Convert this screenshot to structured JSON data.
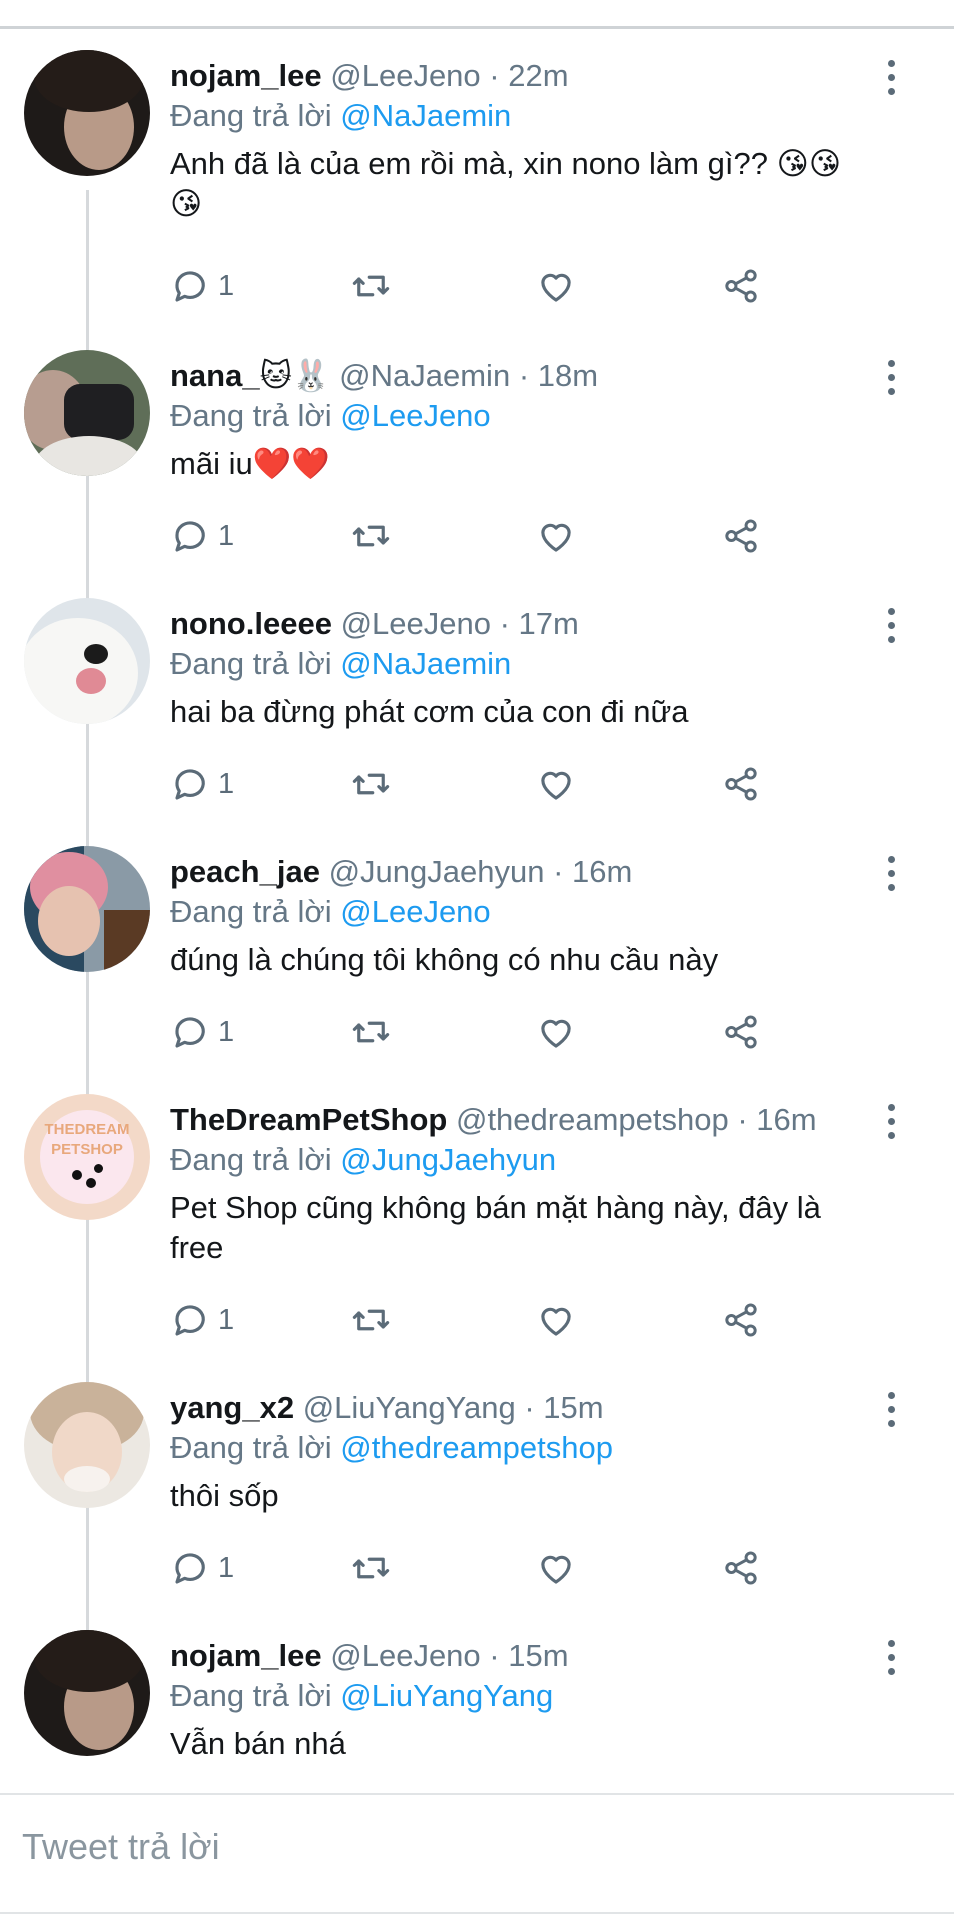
{
  "thread": [
    {
      "name": "nojam_lee",
      "handle": "@LeeJeno",
      "time": "· 22m",
      "reply_prefix": "Đang trả lời",
      "reply_to": "@NaJaemin",
      "text": "Anh đã là của em rồi mà, xin nono làm gì??",
      "emojis": "😘😘😘",
      "reply_count": "1",
      "avatar": "dark-hair-portrait"
    },
    {
      "name": "nana_",
      "name_emojis": "🐱🐰",
      "handle": "@NaJaemin",
      "time": "· 18m",
      "reply_prefix": "Đang trả lời",
      "reply_to": "@LeeJeno",
      "text": "mãi iu",
      "emojis": "❤️❤️",
      "reply_count": "1",
      "avatar": "camera-portrait"
    },
    {
      "name": "nono.leeee",
      "handle": "@LeeJeno",
      "time": "· 17m",
      "reply_prefix": "Đang trả lời",
      "reply_to": "@NaJaemin",
      "text": "hai ba đừng phát cơm của con đi nữa",
      "reply_count": "1",
      "avatar": "white-dog"
    },
    {
      "name": "peach_jae",
      "handle": "@JungJaehyun",
      "time": "· 16m",
      "reply_prefix": "Đang trả lời",
      "reply_to": "@LeeJeno",
      "text": "đúng là chúng tôi không có nhu cầu này",
      "reply_count": "1",
      "avatar": "pink-hair-portrait"
    },
    {
      "name": "TheDreamPetShop",
      "handle": "@thedreampetshop",
      "time": "· 16m",
      "reply_prefix": "Đang trả lời",
      "reply_to": "@JungJaehyun",
      "text": "Pet Shop cũng không bán mặt hàng này, đây là free",
      "reply_count": "1",
      "avatar": "petshop-logo",
      "logo_line1": "THEDREAM",
      "logo_line2": "PETSHOP"
    },
    {
      "name": "yang_x2",
      "handle": "@LiuYangYang",
      "time": "· 15m",
      "reply_prefix": "Đang trả lời",
      "reply_to": "@thedreampetshop",
      "text": "thôi sốp",
      "reply_count": "1",
      "avatar": "light-portrait"
    },
    {
      "name": "nojam_lee",
      "handle": "@LeeJeno",
      "time": "· 15m",
      "reply_prefix": "Đang trả lời",
      "reply_to": "@LiuYangYang",
      "text": "Vẫn bán nhá",
      "avatar": "dark-hair-portrait"
    }
  ],
  "compose": {
    "placeholder": "Tweet trả lời"
  },
  "colors": {
    "link": "#1d9bf0",
    "muted": "#657786",
    "text": "#14171a"
  }
}
